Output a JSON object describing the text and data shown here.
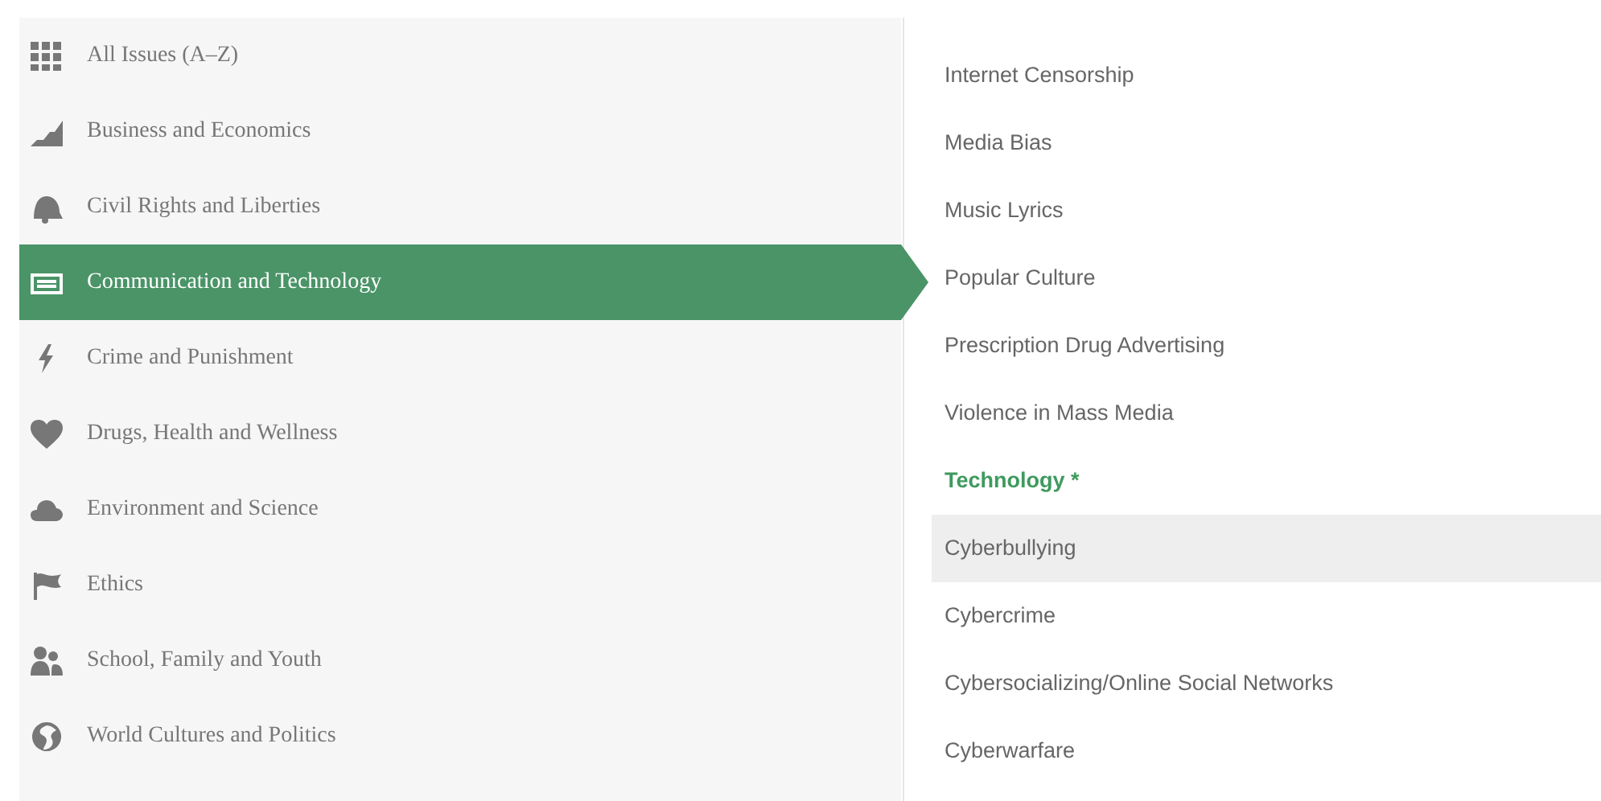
{
  "categories": [
    {
      "label": "All Issues (A–Z)",
      "selected": false
    },
    {
      "label": "Business and Economics",
      "selected": false
    },
    {
      "label": "Civil Rights and Liberties",
      "selected": false
    },
    {
      "label": "Communication and Technology",
      "selected": true
    },
    {
      "label": "Crime and Punishment",
      "selected": false
    },
    {
      "label": "Drugs, Health and Wellness",
      "selected": false
    },
    {
      "label": "Environment and Science",
      "selected": false
    },
    {
      "label": "Ethics",
      "selected": false
    },
    {
      "label": "School, Family and Youth",
      "selected": false
    },
    {
      "label": "World Cultures and Politics",
      "selected": false
    }
  ],
  "topics": [
    {
      "kind": "link",
      "label": "Internet Censorship",
      "highlighted": false
    },
    {
      "kind": "link",
      "label": "Media Bias",
      "highlighted": false
    },
    {
      "kind": "link",
      "label": "Music Lyrics",
      "highlighted": false
    },
    {
      "kind": "link",
      "label": "Popular Culture",
      "highlighted": false
    },
    {
      "kind": "link",
      "label": "Prescription Drug Advertising",
      "highlighted": false
    },
    {
      "kind": "link",
      "label": "Violence in Mass Media",
      "highlighted": false
    },
    {
      "kind": "heading",
      "label": "Technology",
      "mark": "*"
    },
    {
      "kind": "link",
      "label": "Cyberbullying",
      "highlighted": true
    },
    {
      "kind": "link",
      "label": "Cybercrime",
      "highlighted": false
    },
    {
      "kind": "link",
      "label": "Cybersocializing/Online Social Networks",
      "highlighted": false
    },
    {
      "kind": "link",
      "label": "Cyberwarfare",
      "highlighted": false
    }
  ]
}
